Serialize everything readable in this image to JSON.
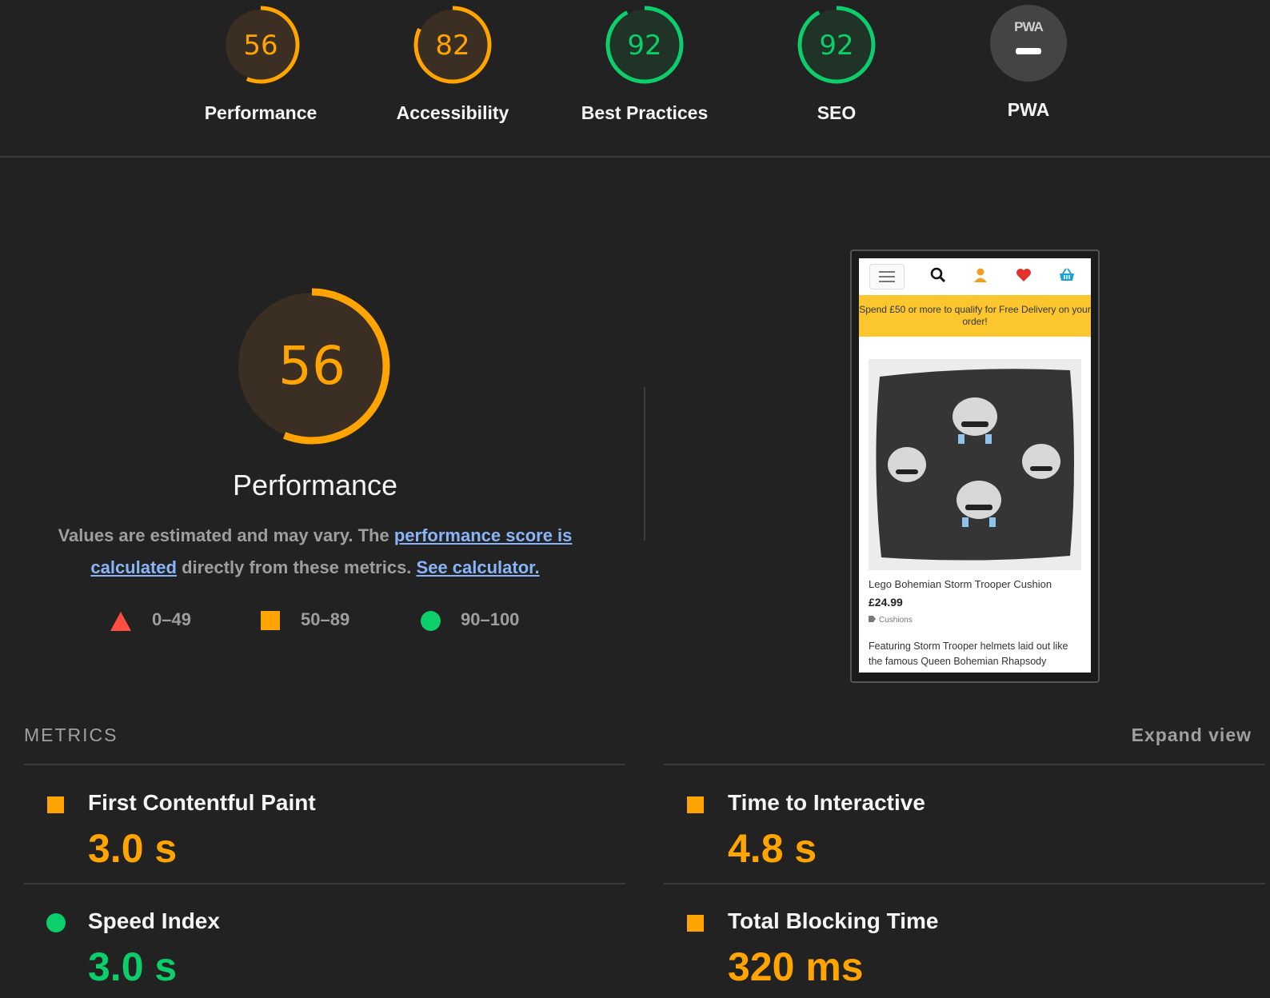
{
  "gauges": [
    {
      "score": "56",
      "label": "Performance",
      "fraction": 0.56,
      "color": "#ffa400"
    },
    {
      "score": "82",
      "label": "Accessibility",
      "fraction": 0.82,
      "color": "#ffa400"
    },
    {
      "score": "92",
      "label": "Best Practices",
      "fraction": 0.92,
      "color": "#0cce6b"
    },
    {
      "score": "92",
      "label": "SEO",
      "fraction": 0.92,
      "color": "#0cce6b"
    }
  ],
  "pwa": {
    "badge_text": "PWA",
    "label": "PWA"
  },
  "performance": {
    "score": "56",
    "fraction": 0.56,
    "title": "Performance",
    "desc_prefix": "Values are estimated and may vary. The ",
    "desc_link1": "performance score is calculated",
    "desc_middle": " directly from these metrics. ",
    "desc_link2": "See calculator."
  },
  "legend": [
    {
      "range": "0–49",
      "icon": "red-triangle-icon",
      "color": "#ff4e42"
    },
    {
      "range": "50–89",
      "icon": "orange-square-icon",
      "color": "#ffa400"
    },
    {
      "range": "90–100",
      "icon": "green-circle-icon",
      "color": "#0cce6b"
    }
  ],
  "screenshot": {
    "banner": "Spend £50 or more to qualify for Free Delivery on your order!",
    "product_name": "Lego Bohemian Storm Trooper Cushion",
    "price": "£24.99",
    "category": "Cushions",
    "description": "Featuring Storm Trooper helmets laid out like the famous Queen Bohemian Rhapsody"
  },
  "metrics": {
    "heading": "METRICS",
    "expand_label": "Expand view",
    "items": [
      {
        "title": "First Contentful Paint",
        "value": "3.0 s",
        "status": "average"
      },
      {
        "title": "Time to Interactive",
        "value": "4.8 s",
        "status": "average"
      },
      {
        "title": "Speed Index",
        "value": "3.0 s",
        "status": "pass"
      },
      {
        "title": "Total Blocking Time",
        "value": "320 ms",
        "status": "average"
      }
    ]
  }
}
